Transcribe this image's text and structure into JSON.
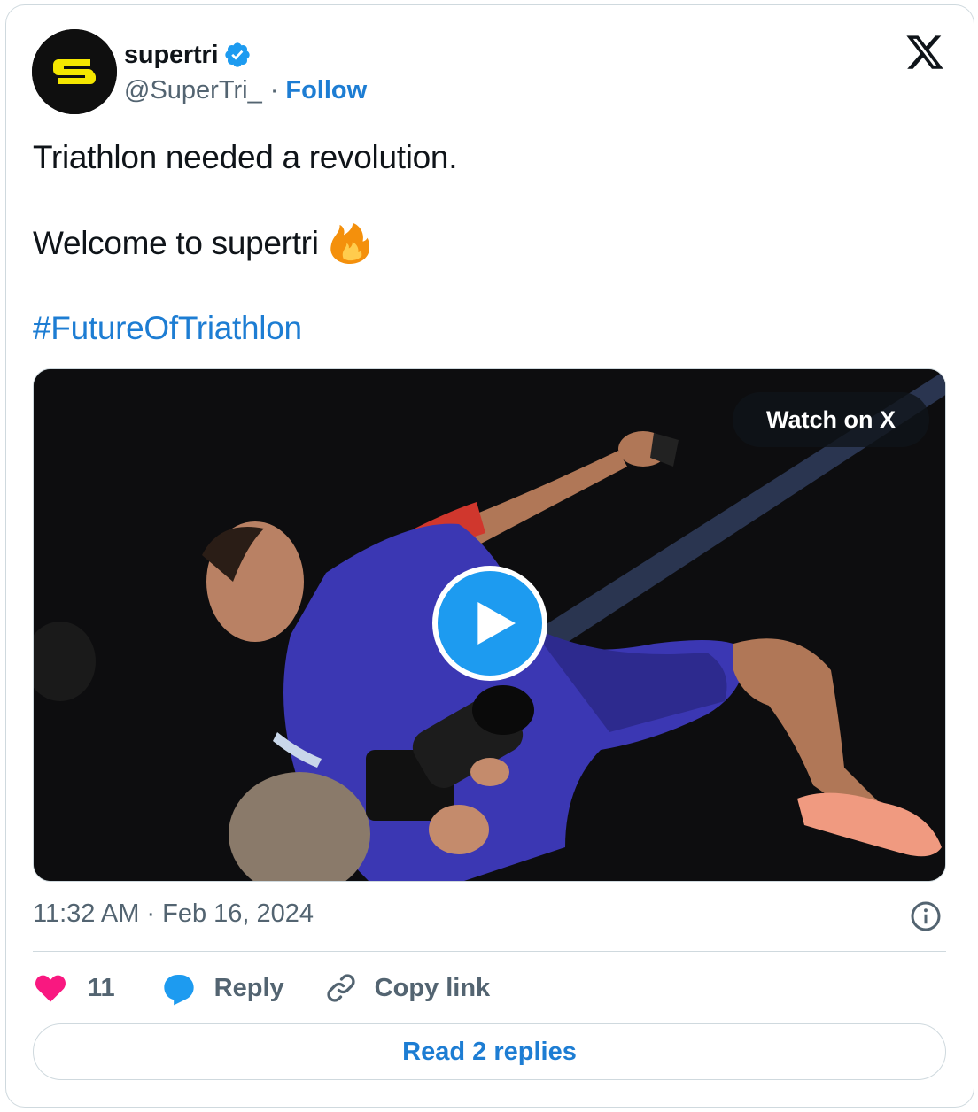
{
  "author": {
    "display_name": "supertri",
    "handle": "@SuperTri_",
    "separator": "·",
    "follow_label": "Follow",
    "verified": true
  },
  "tweet": {
    "line1": "Triathlon needed a revolution.",
    "line2": "Welcome to supertri",
    "emoji": "fire-emoji",
    "hashtag": "#FutureOfTriathlon"
  },
  "media": {
    "watch_label": "Watch on X",
    "type": "video"
  },
  "meta": {
    "timestamp": "11:32 AM · Feb 16, 2024"
  },
  "actions": {
    "like_count": "11",
    "reply_label": "Reply",
    "copy_label": "Copy link"
  },
  "footer": {
    "read_replies_label": "Read 2 replies"
  },
  "colors": {
    "link_blue": "#1d7dd3",
    "verified_blue": "#1d9bf0",
    "heart_pink": "#f91880",
    "muted": "#536471",
    "brand_yellow": "#f4e600"
  }
}
